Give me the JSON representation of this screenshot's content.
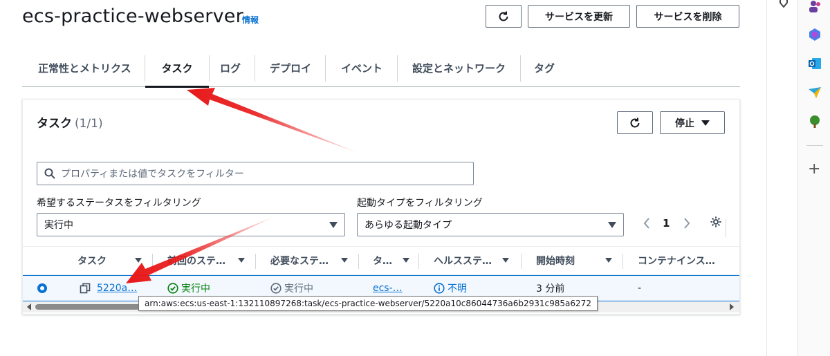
{
  "header": {
    "title": "ecs-practice-webserver",
    "info": "情報",
    "refresh_icon": "refresh-icon",
    "update_label": "サービスを更新",
    "delete_label": "サービスを削除"
  },
  "tabs": [
    {
      "label": "正常性とメトリクス",
      "active": false
    },
    {
      "label": "タスク",
      "active": true
    },
    {
      "label": "ログ",
      "active": false
    },
    {
      "label": "デプロイ",
      "active": false
    },
    {
      "label": "イベント",
      "active": false
    },
    {
      "label": "設定とネットワーク",
      "active": false
    },
    {
      "label": "タグ",
      "active": false
    }
  ],
  "tasks_panel": {
    "title": "タスク",
    "count": "(1/1)",
    "stop_label": "停止",
    "search_placeholder": "プロパティまたは値でタスクをフィルター",
    "status_filter_label": "希望するステータスをフィルタリング",
    "status_filter_value": "実行中",
    "launch_filter_label": "起動タイプをフィルタリング",
    "launch_filter_value": "あらゆる起動タイプ",
    "page": "1",
    "columns": [
      "タスク",
      "前回のステ…",
      "必要なステ…",
      "タ…",
      "ヘルスステ…",
      "開始時刻",
      "コンテナインス…"
    ],
    "row": {
      "task": "5220a…",
      "last_status": "実行中",
      "desired_status": "実行中",
      "task_def": "ecs-…",
      "health": "不明",
      "started": "3 分前",
      "container_instance": "-"
    },
    "tooltip": "arn:aws:ecs:us-east-1:132110897268:task/ecs-practice-webserver/5220a10c86044736a6b2931c985a6272"
  },
  "colors": {
    "link": "#0972d3",
    "success": "#037f0c",
    "arrow": "#e8191a"
  },
  "sidebar_icons": [
    "extension-icon",
    "people-icon",
    "copilot-icon",
    "outlook-icon",
    "send-icon",
    "tree-icon",
    "add-icon"
  ]
}
